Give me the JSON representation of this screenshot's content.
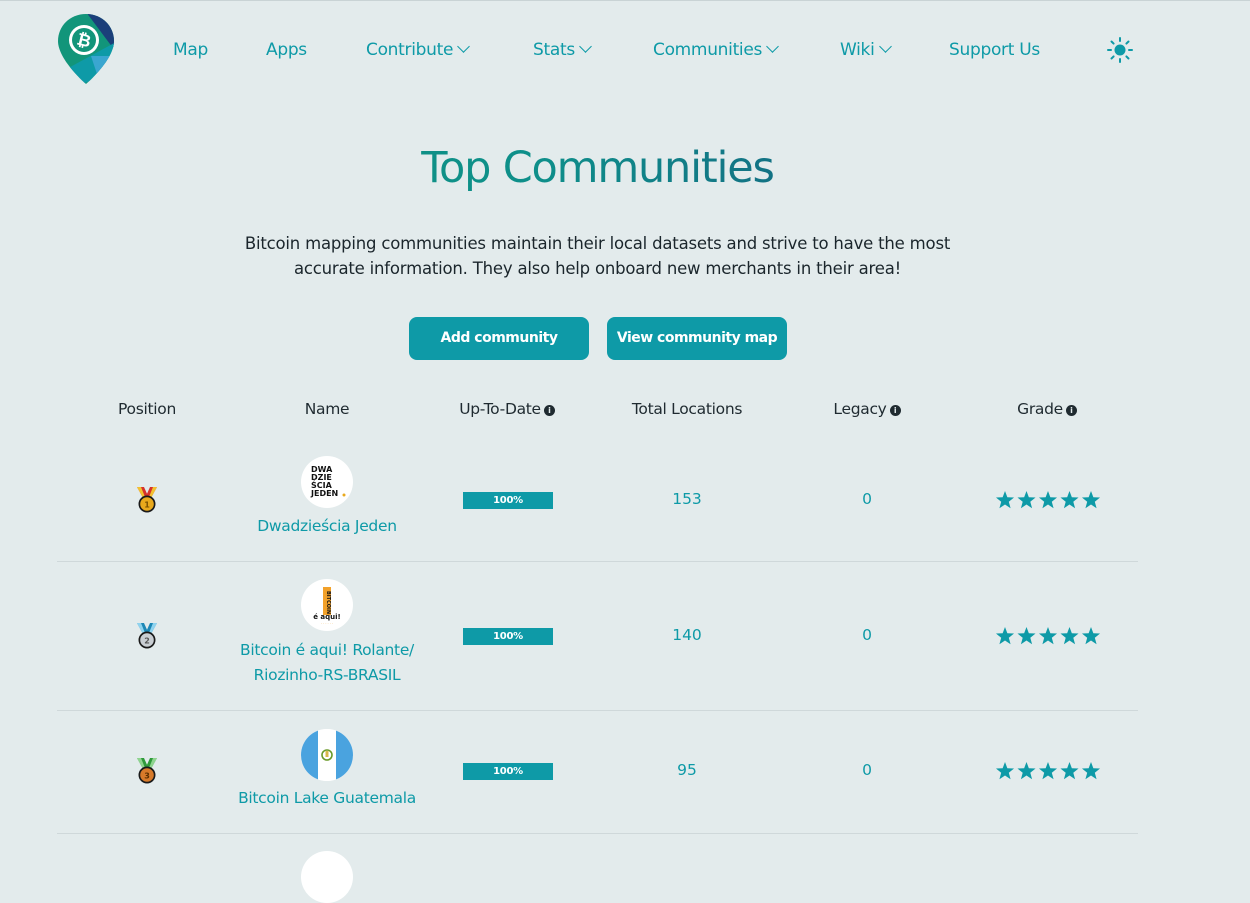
{
  "nav": {
    "items": [
      {
        "label": "Map"
      },
      {
        "label": "Apps"
      },
      {
        "label": "Contribute"
      },
      {
        "label": "Stats"
      },
      {
        "label": "Communities"
      },
      {
        "label": "Wiki"
      },
      {
        "label": "Support Us"
      }
    ],
    "theme_icon": "sun-icon"
  },
  "hero": {
    "title": "Top Communities",
    "description": "Bitcoin mapping communities maintain their local datasets and strive to have the most accurate information. They also help onboard new merchants in their area!",
    "add_button": "Add community",
    "map_button": "View community map"
  },
  "table": {
    "headers": {
      "position": "Position",
      "name": "Name",
      "up_to_date": "Up-To-Date",
      "total_locations": "Total Locations",
      "legacy": "Legacy",
      "grade": "Grade"
    },
    "rows": [
      {
        "rank": 1,
        "medal": "gold-medal-icon",
        "name": "Dwadzieścia Jeden",
        "avatar_text": "DWA DZIE ŚCIA JEDEN",
        "up_to_date": "100%",
        "up_to_date_value": 100,
        "total_locations": "153",
        "legacy": "0",
        "grade": 5
      },
      {
        "rank": 2,
        "medal": "silver-medal-icon",
        "name": "Bitcoin é aqui! Rolante/ Riozinho-RS-BRASIL",
        "avatar_text": "BITCOIN é aqui!",
        "up_to_date": "100%",
        "up_to_date_value": 100,
        "total_locations": "140",
        "legacy": "0",
        "grade": 5
      },
      {
        "rank": 3,
        "medal": "bronze-medal-icon",
        "name": "Bitcoin Lake Guatemala",
        "avatar_text": "",
        "up_to_date": "100%",
        "up_to_date_value": 100,
        "total_locations": "95",
        "legacy": "0",
        "grade": 5
      }
    ]
  },
  "colors": {
    "accent": "#0e9aa7",
    "background": "#e3ebec",
    "text": "#1f2a30",
    "gold": "#e9a91c",
    "medal_ribbon_red": "#d6322b"
  }
}
